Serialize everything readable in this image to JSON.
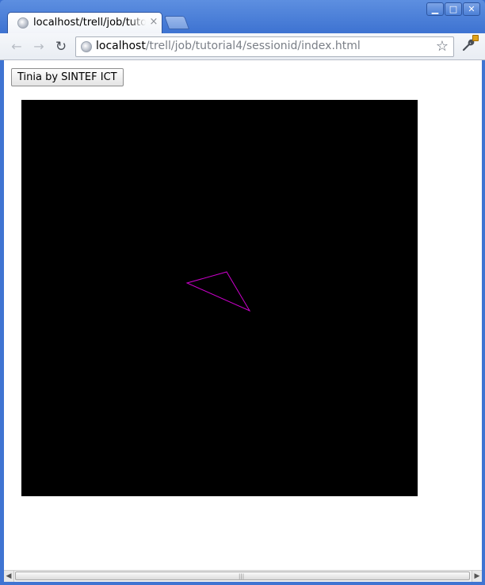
{
  "browser": {
    "tab": {
      "title": "localhost/trell/job/tutorial4/sessionid/index.html",
      "close_glyph": "×",
      "favicon": "globe-icon"
    },
    "window_buttons": {
      "minimize": "▁",
      "maximize": "□",
      "close": "✕"
    },
    "toolbar": {
      "back_glyph": "←",
      "forward_glyph": "→",
      "reload_glyph": "↻",
      "url_host": "localhost",
      "url_path": "/trell/job/tutorial4/sessionid/index.html",
      "star_glyph": "☆",
      "wrench_glyph": "🔧"
    }
  },
  "page": {
    "button_label": "Tinia by SINTEF ICT",
    "canvas": {
      "background": "#000000",
      "triangle_color": "#cc00cc"
    }
  },
  "scrollbar": {
    "left_glyph": "◀",
    "right_glyph": "▶",
    "grip": "|||"
  }
}
